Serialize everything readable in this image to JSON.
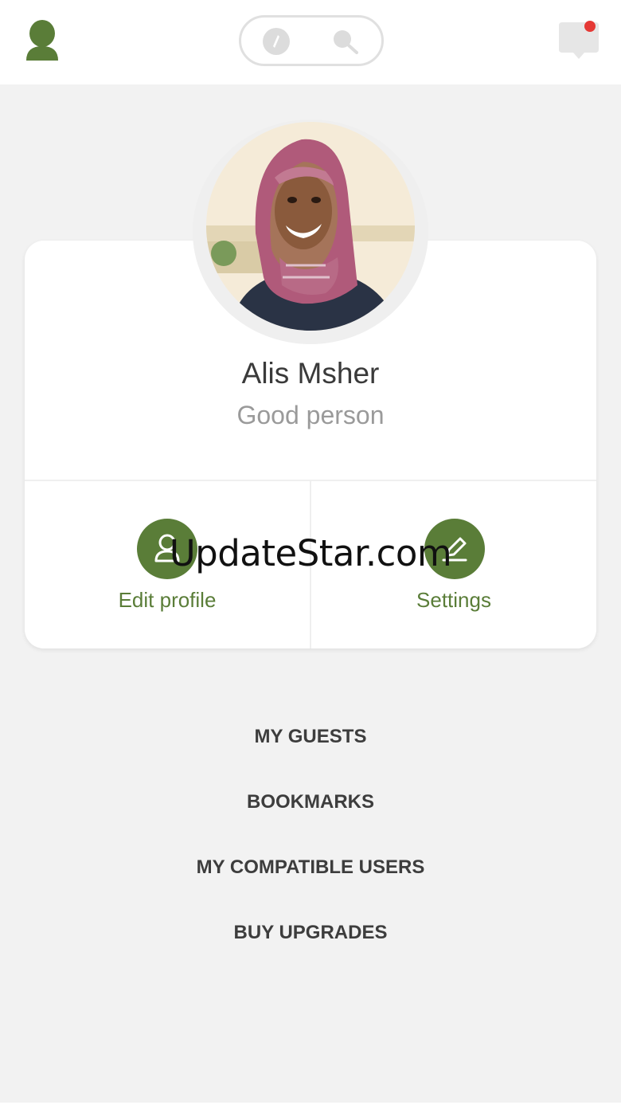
{
  "colors": {
    "accent": "#5a7d38",
    "notification_dot": "#e53935",
    "background": "#f2f2f2"
  },
  "header": {
    "profile_icon": "user-silhouette-icon",
    "toggle": {
      "left_icon": "compass-icon",
      "right_icon": "search-icon"
    },
    "messages_icon": "chat-bubble-icon",
    "has_notification": true
  },
  "profile": {
    "name": "Alis Msher",
    "status": "Good person"
  },
  "actions": {
    "edit": {
      "label": "Edit profile",
      "icon": "user-outline-icon"
    },
    "settings": {
      "label": "Settings",
      "icon": "pencil-icon"
    }
  },
  "watermark": "UpdateStar.com",
  "menu": [
    {
      "label": "MY GUESTS"
    },
    {
      "label": "BOOKMARKS"
    },
    {
      "label": "MY COMPATIBLE USERS"
    },
    {
      "label": "BUY UPGRADES"
    }
  ]
}
